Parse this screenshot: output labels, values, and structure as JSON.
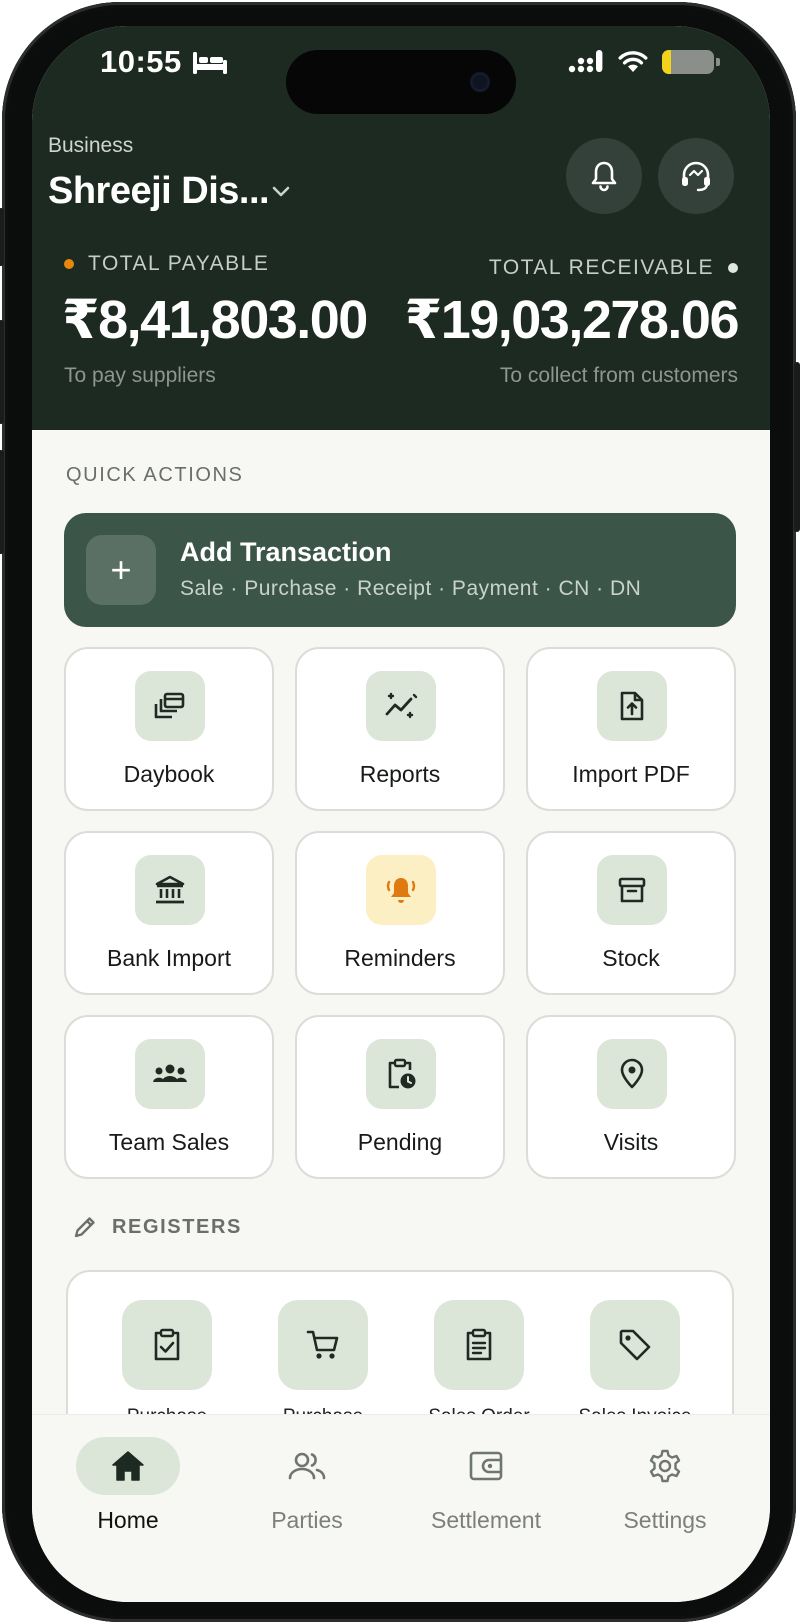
{
  "status_bar": {
    "time": "10:55"
  },
  "header": {
    "business_label": "Business",
    "business_name": "Shreeji Dis...",
    "payable": {
      "label": "TOTAL PAYABLE",
      "amount": "₹8,41,803.00",
      "sub": "To pay suppliers",
      "dot_color": "#e8870d"
    },
    "receivable": {
      "label": "TOTAL RECEIVABLE",
      "amount": "₹19,03,278.06",
      "sub": "To collect from customers",
      "dot_color": "#dfe8e0"
    }
  },
  "quick_actions": {
    "label": "QUICK ACTIONS",
    "add_transaction": {
      "plus": "+",
      "title": "Add Transaction",
      "subtitle": "Sale · Purchase · Receipt · Payment · CN · DN"
    },
    "tiles": [
      {
        "label": "Daybook",
        "icon": "daybook-icon"
      },
      {
        "label": "Reports",
        "icon": "reports-icon"
      },
      {
        "label": "Import PDF",
        "icon": "import-pdf-icon"
      },
      {
        "label": "Bank Import",
        "icon": "bank-icon"
      },
      {
        "label": "Reminders",
        "icon": "bell-ringing-icon"
      },
      {
        "label": "Stock",
        "icon": "archive-box-icon"
      },
      {
        "label": "Team Sales",
        "icon": "team-icon"
      },
      {
        "label": "Pending",
        "icon": "clipboard-clock-icon"
      },
      {
        "label": "Visits",
        "icon": "location-pin-icon"
      }
    ]
  },
  "registers": {
    "label": "REGISTERS",
    "items": [
      {
        "label": "Purchase",
        "icon": "clipboard-check-icon"
      },
      {
        "label": "Purchase",
        "icon": "cart-icon"
      },
      {
        "label": "Sales Order",
        "icon": "clipboard-list-icon"
      },
      {
        "label": "Sales Invoice",
        "icon": "tag-icon"
      }
    ]
  },
  "bottom_nav": {
    "items": [
      {
        "label": "Home",
        "icon": "home-icon",
        "active": true
      },
      {
        "label": "Parties",
        "icon": "parties-icon",
        "active": false
      },
      {
        "label": "Settlement",
        "icon": "wallet-icon",
        "active": false
      },
      {
        "label": "Settings",
        "icon": "gear-icon",
        "active": false
      }
    ]
  },
  "colors": {
    "header_bg": "#1c2a22",
    "accent": "#3b5548",
    "icon_tint_bg": "#dbe6d8",
    "warning_tint_bg": "#fcefc4",
    "warning_icon": "#e07a10"
  }
}
